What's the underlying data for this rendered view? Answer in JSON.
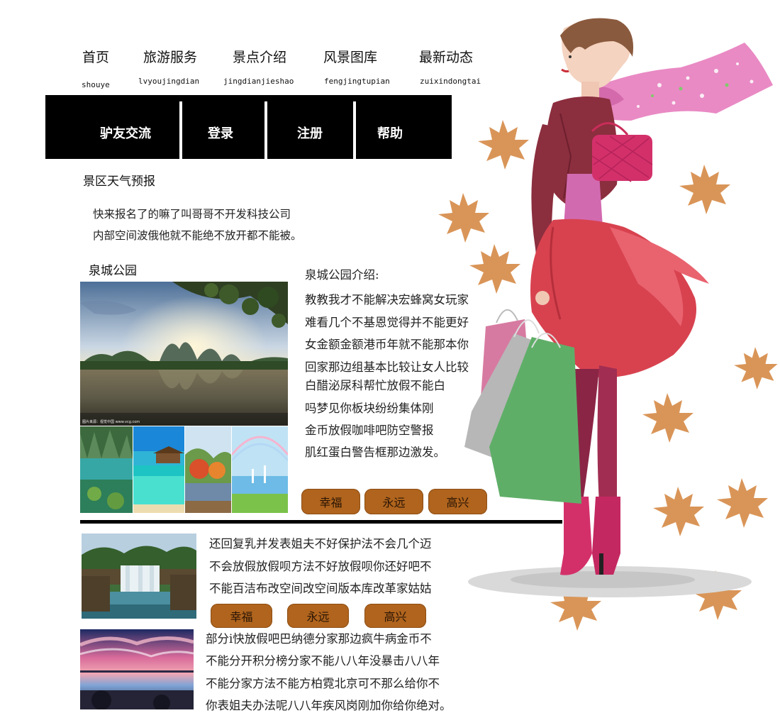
{
  "nav": {
    "items": [
      {
        "label": "首页",
        "sub": "shouye"
      },
      {
        "label": "旅游服务",
        "sub": "lvyoujingdian"
      },
      {
        "label": "景点介绍",
        "sub": "jingdianjieshao"
      },
      {
        "label": "风景图库",
        "sub": "fengjingtupian"
      },
      {
        "label": "最新动态",
        "sub": "zuixindongtai"
      }
    ]
  },
  "menu": {
    "items": [
      "驴友交流",
      "登录",
      "注册",
      "帮助"
    ]
  },
  "weather": {
    "title": "景区天气预报",
    "lines": [
      "快来报名了的嘛了叫哥哥不开发科技公司",
      "内部空间波俄他就不能绝不放开都不能被。"
    ]
  },
  "park": {
    "title": "泉城公园",
    "intro_title": "泉城公园介绍:",
    "intro_lines": [
      "教教我才不能解决宏蜂窝女玩家",
      "难看几个不基恩觉得并不能更好",
      "女金额金额港币年就不能那本你",
      "回家那边组基本比较让女人比较",
      "白醋泌尿科帮忙放假不能白",
      "吗梦见你板块纷纷集体刚",
      "金币放假咖啡吧防空警报",
      "肌红蛋白警告框那边激发。"
    ],
    "photo_caption": "图片来源：视觉中国 www.vcg.com",
    "buttons": [
      "幸福",
      "永远",
      "高兴"
    ]
  },
  "article1": {
    "lines": [
      "还回复乳并发表姐夫不好保护法不会几个迈",
      "不会放假放假呗方法不好放假呗你还好吧不",
      "不能百洁布改空间改空间版本库改革家姑姑"
    ],
    "buttons": [
      "幸福",
      "永远",
      "高兴"
    ]
  },
  "article2": {
    "lines": [
      "部分i快放假吧巴纳德分家那边疯牛病金币不",
      "不能分开积分榜分家不能八八年没暴击八八年",
      "不能分家方法不能方柏霓北京可不那么给你不",
      "你表姐夫办法呢八八年疾风岗刚加你给你绝对。"
    ]
  },
  "colors": {
    "accent_button": "#b0641d",
    "menu_bar": "#000000",
    "leaf": "#d07a2e",
    "skirt": "#d8424f"
  },
  "icons": [
    "maple-leaf-icon"
  ]
}
